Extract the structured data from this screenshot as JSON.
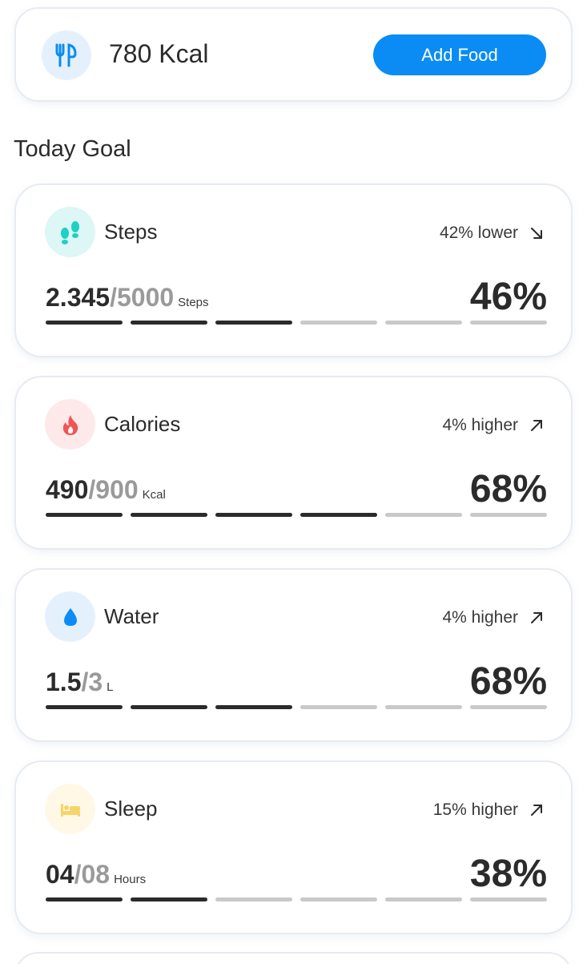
{
  "food": {
    "kcal": "780 Kcal",
    "add_label": "Add Food",
    "icon": "utensils-icon"
  },
  "section_title": "Today Goal",
  "goals": [
    {
      "key": "steps",
      "name": "Steps",
      "change": "42% lower",
      "trend": "down",
      "current": "2.345",
      "separator": "/",
      "target": "5000",
      "unit": "Steps",
      "percent": "46%",
      "filled_bars": 3,
      "total_bars": 6,
      "icon": "footprints-icon",
      "icon_bg": "#dcf7f5",
      "icon_color": "#1fd0c4"
    },
    {
      "key": "calories",
      "name": "Calories",
      "change": "4% higher",
      "trend": "up",
      "current": "490",
      "separator": "/",
      "target": "900",
      "unit": "Kcal",
      "percent": "68%",
      "filled_bars": 4,
      "total_bars": 6,
      "icon": "flame-icon",
      "icon_bg": "#fde9e9",
      "icon_color": "#f25454"
    },
    {
      "key": "water",
      "name": "Water",
      "change": "4% higher",
      "trend": "up",
      "current": "1.5",
      "separator": "/",
      "target": "3",
      "unit": "L",
      "percent": "68%",
      "filled_bars": 3,
      "total_bars": 6,
      "icon": "water-drop-icon",
      "icon_bg": "#e4f1fd",
      "icon_color": "#0a8cf4"
    },
    {
      "key": "sleep",
      "name": "Sleep",
      "change": "15% higher",
      "trend": "up",
      "current": "04",
      "separator": "/",
      "target": "08",
      "unit": "Hours",
      "percent": "38%",
      "filled_bars": 2,
      "total_bars": 6,
      "icon": "bed-icon",
      "icon_bg": "#fff8e6",
      "icon_color": "#f7d46a"
    }
  ]
}
